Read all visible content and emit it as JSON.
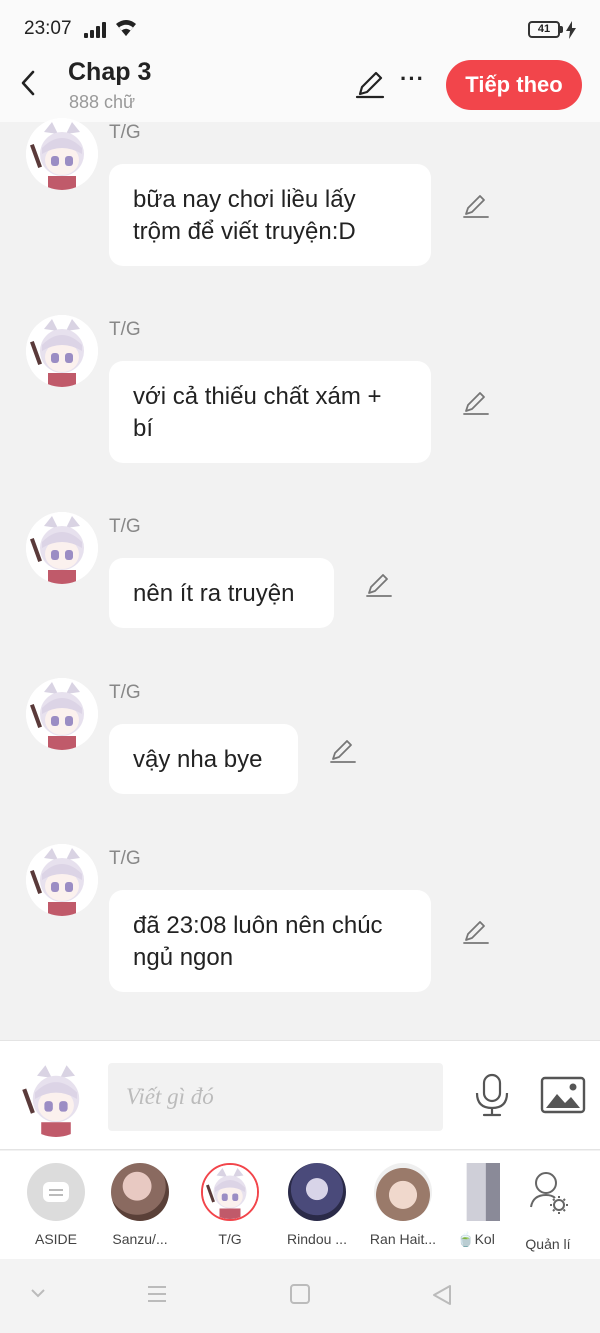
{
  "status": {
    "time": "23:07",
    "battery": "41"
  },
  "header": {
    "title": "Chap 3",
    "subtitle": "888 chữ",
    "next_label": "Tiếp theo",
    "more_label": "···"
  },
  "messages": [
    {
      "sender": "T/G",
      "text": "bữa nay chơi liều lấy trộm để viết truyện:D"
    },
    {
      "sender": "T/G",
      "text": "với cả thiếu chất xám + bí"
    },
    {
      "sender": "T/G",
      "text": "nên ít ra truyện"
    },
    {
      "sender": "T/G",
      "text": "vậy nha bye"
    },
    {
      "sender": "T/G",
      "text": "đã 23:08 luôn nên chúc ngủ ngon"
    }
  ],
  "composer": {
    "placeholder": "Viết gì đó"
  },
  "characters": [
    {
      "label": "ASIDE"
    },
    {
      "label": "Sanzu/..."
    },
    {
      "label": "T/G"
    },
    {
      "label": "Rindou ..."
    },
    {
      "label": "Ran Hait..."
    },
    {
      "label": "🍵Kol"
    },
    {
      "label": "Quản lí"
    }
  ],
  "colors": {
    "accent": "#f2454b",
    "background": "#f2f2f2",
    "bubble": "#ffffff"
  },
  "icons": {
    "back": "chevron-left-icon",
    "edit": "pencil-icon",
    "mic": "microphone-icon",
    "image": "image-icon",
    "manage": "user-gear-icon"
  }
}
